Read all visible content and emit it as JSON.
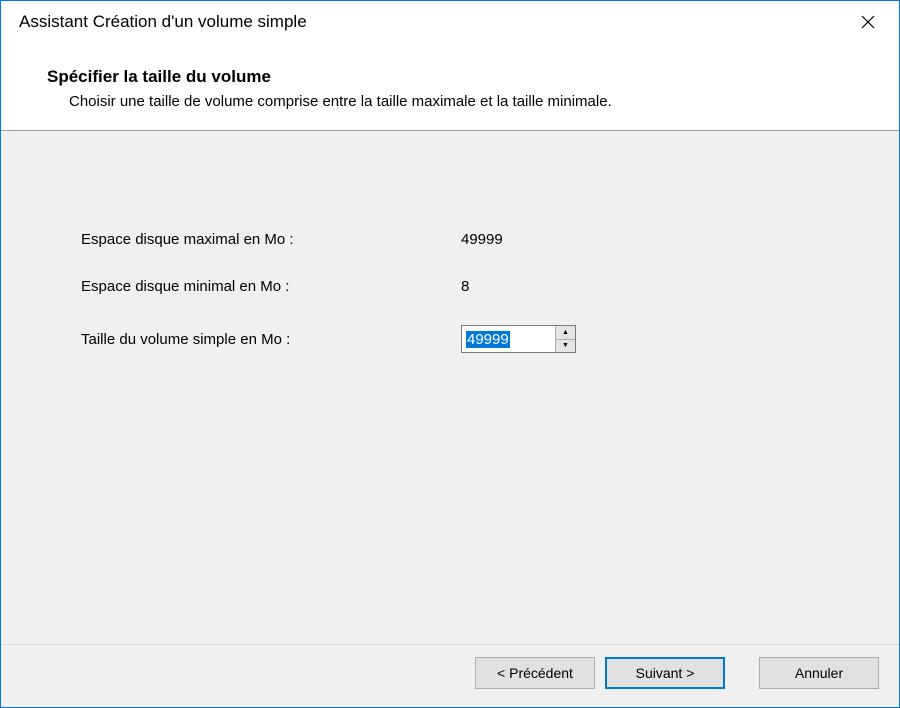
{
  "window": {
    "title": "Assistant Création d'un volume simple"
  },
  "header": {
    "heading": "Spécifier la taille du volume",
    "subheading": "Choisir une taille de volume comprise entre la taille maximale et la taille minimale."
  },
  "fields": {
    "max_label": "Espace disque maximal en Mo :",
    "max_value": "49999",
    "min_label": "Espace disque minimal en Mo :",
    "min_value": "8",
    "size_label": "Taille du volume simple en Mo :",
    "size_value": "49999"
  },
  "buttons": {
    "back": "< Précédent",
    "next": "Suivant >",
    "cancel": "Annuler"
  }
}
